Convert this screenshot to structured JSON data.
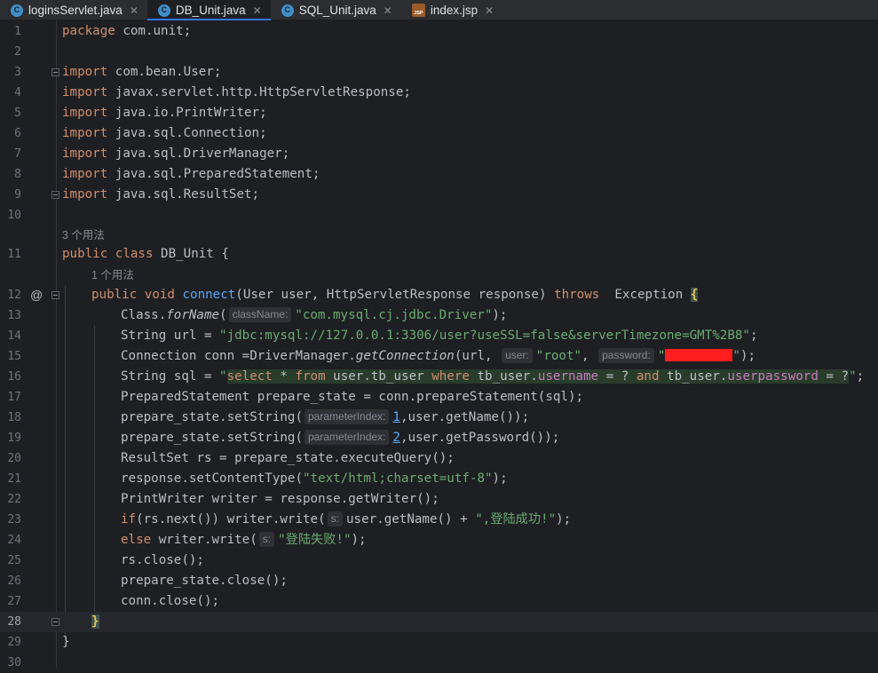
{
  "tabs": [
    {
      "label": "loginsServlet.java",
      "icon": "java-class-icon",
      "glyph": "C"
    },
    {
      "label": "DB_Unit.java",
      "icon": "java-class-icon",
      "glyph": "C"
    },
    {
      "label": "SQL_Unit.java",
      "icon": "java-class-icon",
      "glyph": "C"
    },
    {
      "label": "index.jsp",
      "icon": "jsp-file-icon",
      "glyph": "JSP"
    }
  ],
  "editor": {
    "line_numbers": [
      "1",
      "2",
      "3",
      "4",
      "5",
      "6",
      "7",
      "8",
      "9",
      "10",
      "11",
      "12",
      "13",
      "14",
      "15",
      "16",
      "17",
      "18",
      "19",
      "20",
      "21",
      "22",
      "23",
      "24",
      "25",
      "26",
      "27",
      "28",
      "29",
      "30"
    ],
    "current_line": "28",
    "usage_hint_class": "3 个用法",
    "usage_hint_method": "1 个用法",
    "override_marker": "@"
  },
  "code": {
    "l1": [
      "package",
      " com.unit;"
    ],
    "l3": [
      "import",
      " com.bean.User;"
    ],
    "l4": [
      "import",
      " javax.servlet.http.HttpServletResponse;"
    ],
    "l5": [
      "import",
      " java.io.PrintWriter;"
    ],
    "l6": [
      "import",
      " java.sql.Connection;"
    ],
    "l7": [
      "import",
      " java.sql.DriverManager;"
    ],
    "l8": [
      "import",
      " java.sql.PreparedStatement;"
    ],
    "l9": [
      "import",
      " java.sql.ResultSet;"
    ],
    "l11": [
      "public class",
      " DB_Unit {"
    ],
    "l12": [
      "public void ",
      "connect",
      "(User user, HttpServletResponse response) ",
      "throws",
      "  Exception ",
      "{"
    ],
    "l13": [
      "Class.",
      "forName",
      "(",
      "className:",
      "\"com.mysql.cj.jdbc.Driver\"",
      ");"
    ],
    "l14": [
      "String url = ",
      "\"jdbc:mysql://127.0.0.1:3306/user?useSSL=false&serverTimezone=GMT%2B8\"",
      ";"
    ],
    "l15": [
      "Connection conn =DriverManager.",
      "getConnection",
      "(url, ",
      "user:",
      "\"root\"",
      ", ",
      "password:",
      "\"",
      "\"",
      ");"
    ],
    "l16": [
      "String sql = ",
      "\"",
      "select",
      " * ",
      "from",
      " user.tb_user ",
      "where",
      " tb_user.",
      "username",
      " = ? ",
      "and",
      " tb_user.",
      "userpassword",
      " = ?",
      "\"",
      ";"
    ],
    "l17": [
      "PreparedStatement prepare_state = conn.prepareStatement(sql);"
    ],
    "l18": [
      "prepare_state.setString(",
      "parameterIndex:",
      "1",
      ",user.getName());"
    ],
    "l19": [
      "prepare_state.setString(",
      "parameterIndex:",
      "2",
      ",user.getPassword());"
    ],
    "l20": [
      "ResultSet rs = prepare_state.executeQuery();"
    ],
    "l21": [
      "response.setContentType(",
      "\"text/html;charset=utf-8\"",
      ");"
    ],
    "l22": [
      "PrintWriter writer = response.getWriter();"
    ],
    "l23": [
      "if",
      "(rs.next()) writer.write(",
      "s:",
      "user.getName() + ",
      "\",登陆成功!\"",
      ");"
    ],
    "l24": [
      "else",
      " writer.write(",
      "s:",
      "\"登陆失败!\"",
      ");"
    ],
    "l25": [
      "rs.close();"
    ],
    "l26": [
      "prepare_state.close();"
    ],
    "l27": [
      "conn.close();"
    ],
    "l28": [
      "}"
    ],
    "l29": [
      "}"
    ]
  },
  "colors": {
    "background": "#1e1f22",
    "keyword": "#cf8e6d",
    "string": "#6aab73",
    "method": "#56a8f5",
    "field": "#c77dbb",
    "redaction": "#ff1e1e",
    "tab_active_underline": "#3574f0"
  }
}
